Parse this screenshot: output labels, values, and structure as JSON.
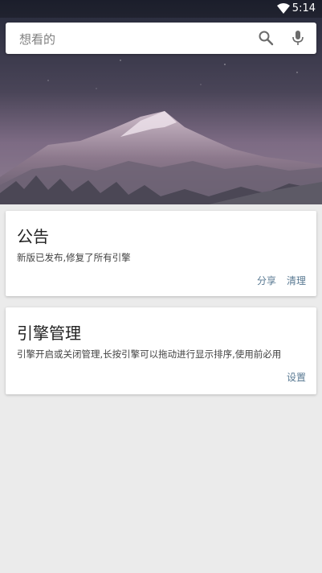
{
  "status_bar": {
    "time": "5:14"
  },
  "search": {
    "placeholder": "想看的",
    "search_icon": "search-icon",
    "mic_icon": "mic-icon"
  },
  "notice_card": {
    "title": "公告",
    "text": "新版已发布,修复了所有引擎",
    "actions": [
      "分享",
      "清理"
    ]
  },
  "engine_card": {
    "title": "引擎管理",
    "text": "引擎开启或关闭管理,长按引擎可以拖动进行显示排序,使用前必用",
    "actions": [
      "设置"
    ]
  },
  "colors": {
    "accent_text": "#5a7a93",
    "background": "#ebebeb",
    "card": "#ffffff"
  }
}
